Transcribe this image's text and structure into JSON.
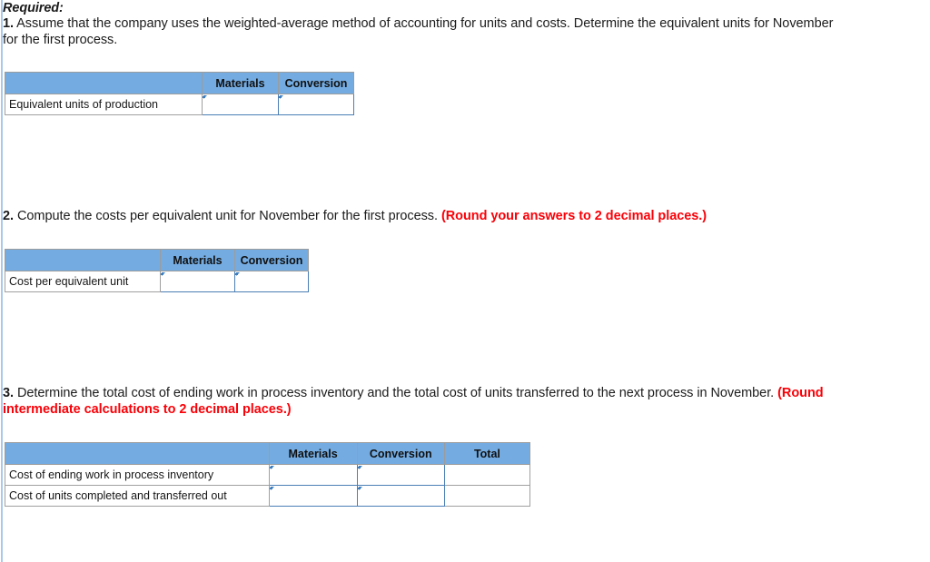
{
  "document": {
    "required_heading": "Required:"
  },
  "questions": [
    {
      "number": "1.",
      "text": " Assume that the company uses the weighted-average method of accounting for units and costs. Determine the equivalent units for November for the first process.",
      "note": ""
    },
    {
      "number": "2.",
      "text": " Compute the costs per equivalent unit for November for the first process. ",
      "note": "(Round your answers to 2 decimal places.)"
    },
    {
      "number": "3.",
      "text": " Determine the total cost of ending work in process inventory and the total cost of units transferred to the next process in November. ",
      "note": "(Round intermediate calculations to 2 decimal places.)"
    }
  ],
  "tables": [
    {
      "id": "equivalent-units-table",
      "headers": [
        "",
        "Materials",
        "Conversion"
      ],
      "rows": [
        {
          "label": "Equivalent units of production",
          "cells": [
            {
              "type": "input",
              "value": ""
            },
            {
              "type": "input",
              "value": ""
            }
          ]
        }
      ]
    },
    {
      "id": "cost-per-equivalent-unit-table",
      "headers": [
        "",
        "Materials",
        "Conversion"
      ],
      "rows": [
        {
          "label": "Cost per equivalent unit",
          "cells": [
            {
              "type": "input",
              "value": ""
            },
            {
              "type": "input",
              "value": ""
            }
          ]
        }
      ]
    },
    {
      "id": "total-cost-table",
      "headers": [
        "",
        "Materials",
        "Conversion",
        "Total"
      ],
      "rows": [
        {
          "label": "Cost of ending work in process inventory",
          "cells": [
            {
              "type": "input",
              "value": ""
            },
            {
              "type": "input",
              "value": ""
            },
            {
              "type": "plain",
              "value": ""
            }
          ]
        },
        {
          "label": "Cost of units completed and transferred out",
          "cells": [
            {
              "type": "input",
              "value": ""
            },
            {
              "type": "input",
              "value": ""
            },
            {
              "type": "plain",
              "value": ""
            }
          ]
        }
      ]
    }
  ],
  "colors": {
    "header_blue": "#74ACE2",
    "input_border_blue": "#4A7FB5",
    "corner_flag_blue": "#3D7FC1",
    "note_red": "#FB0007",
    "rail_blue": "#A9C9EC",
    "grid_gray": "#A0A0A0"
  }
}
